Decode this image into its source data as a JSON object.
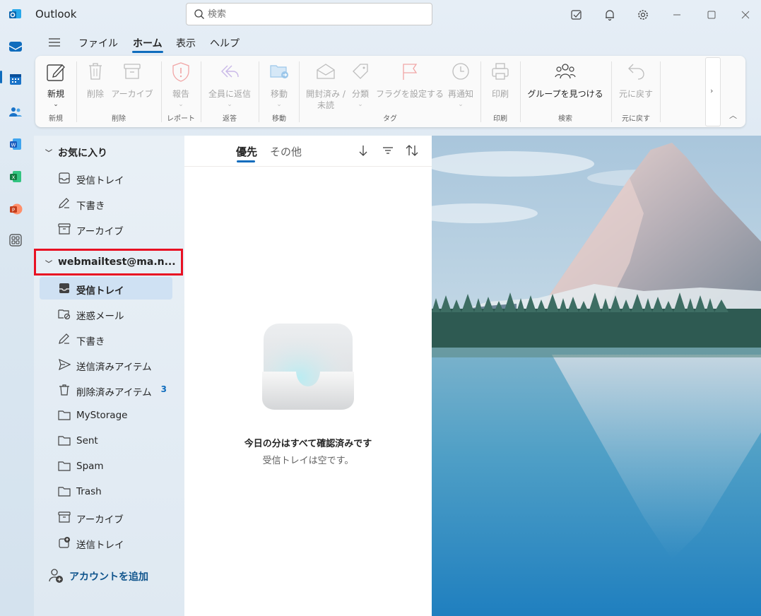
{
  "app": {
    "title": "Outlook"
  },
  "search": {
    "placeholder": "検索",
    "value": ""
  },
  "menu": {
    "tabs": [
      {
        "label": "ファイル"
      },
      {
        "label": "ホーム"
      },
      {
        "label": "表示"
      },
      {
        "label": "ヘルプ"
      }
    ],
    "active_tab": "ホーム"
  },
  "ribbon": {
    "buttons": {
      "new": "新規",
      "delete": "削除",
      "archive": "アーカイブ",
      "report": "報告",
      "reply_all": "全員に返信",
      "move": "移動",
      "read_unread_1": "開封済み /",
      "read_unread_2": "未読",
      "categorize": "分類",
      "flag": "フラグを設定する",
      "snooze": "再通知",
      "print": "印刷",
      "find_groups": "グループを見つける",
      "undo": "元に戻す"
    },
    "groups": {
      "new": "新規",
      "delete": "削除",
      "report": "レポート",
      "respond": "返答",
      "move": "移動",
      "tags": "タグ",
      "print": "印刷",
      "find": "検索",
      "undo": "元に戻す"
    }
  },
  "folders": {
    "favorites": {
      "header": "お気に入り",
      "items": [
        {
          "label": "受信トレイ",
          "icon": "inbox-icon"
        },
        {
          "label": "下書き",
          "icon": "drafts-icon"
        },
        {
          "label": "アーカイブ",
          "icon": "archive-icon"
        }
      ]
    },
    "account": {
      "header": "webmailtest@ma.n...",
      "items": [
        {
          "label": "受信トレイ",
          "icon": "inbox-icon",
          "selected": true
        },
        {
          "label": "迷惑メール",
          "icon": "junk-icon"
        },
        {
          "label": "下書き",
          "icon": "drafts-icon"
        },
        {
          "label": "送信済みアイテム",
          "icon": "sent-icon"
        },
        {
          "label": "削除済みアイテム",
          "icon": "trash-icon",
          "count": "3"
        },
        {
          "label": "MyStorage",
          "icon": "folder-icon"
        },
        {
          "label": "Sent",
          "icon": "folder-icon"
        },
        {
          "label": "Spam",
          "icon": "folder-icon"
        },
        {
          "label": "Trash",
          "icon": "folder-icon"
        },
        {
          "label": "アーカイブ",
          "icon": "archive-icon"
        },
        {
          "label": "送信トレイ",
          "icon": "outbox-icon"
        }
      ]
    },
    "add_account": "アカウントを追加"
  },
  "message_list": {
    "tabs": {
      "focused": "優先",
      "other": "その他"
    },
    "empty_title": "今日の分はすべて確認済みです",
    "empty_subtitle": "受信トレイは空です。"
  },
  "colors": {
    "accent": "#0f6cbd",
    "highlight": "#e81123",
    "selected_bg": "#cfe1f3"
  }
}
